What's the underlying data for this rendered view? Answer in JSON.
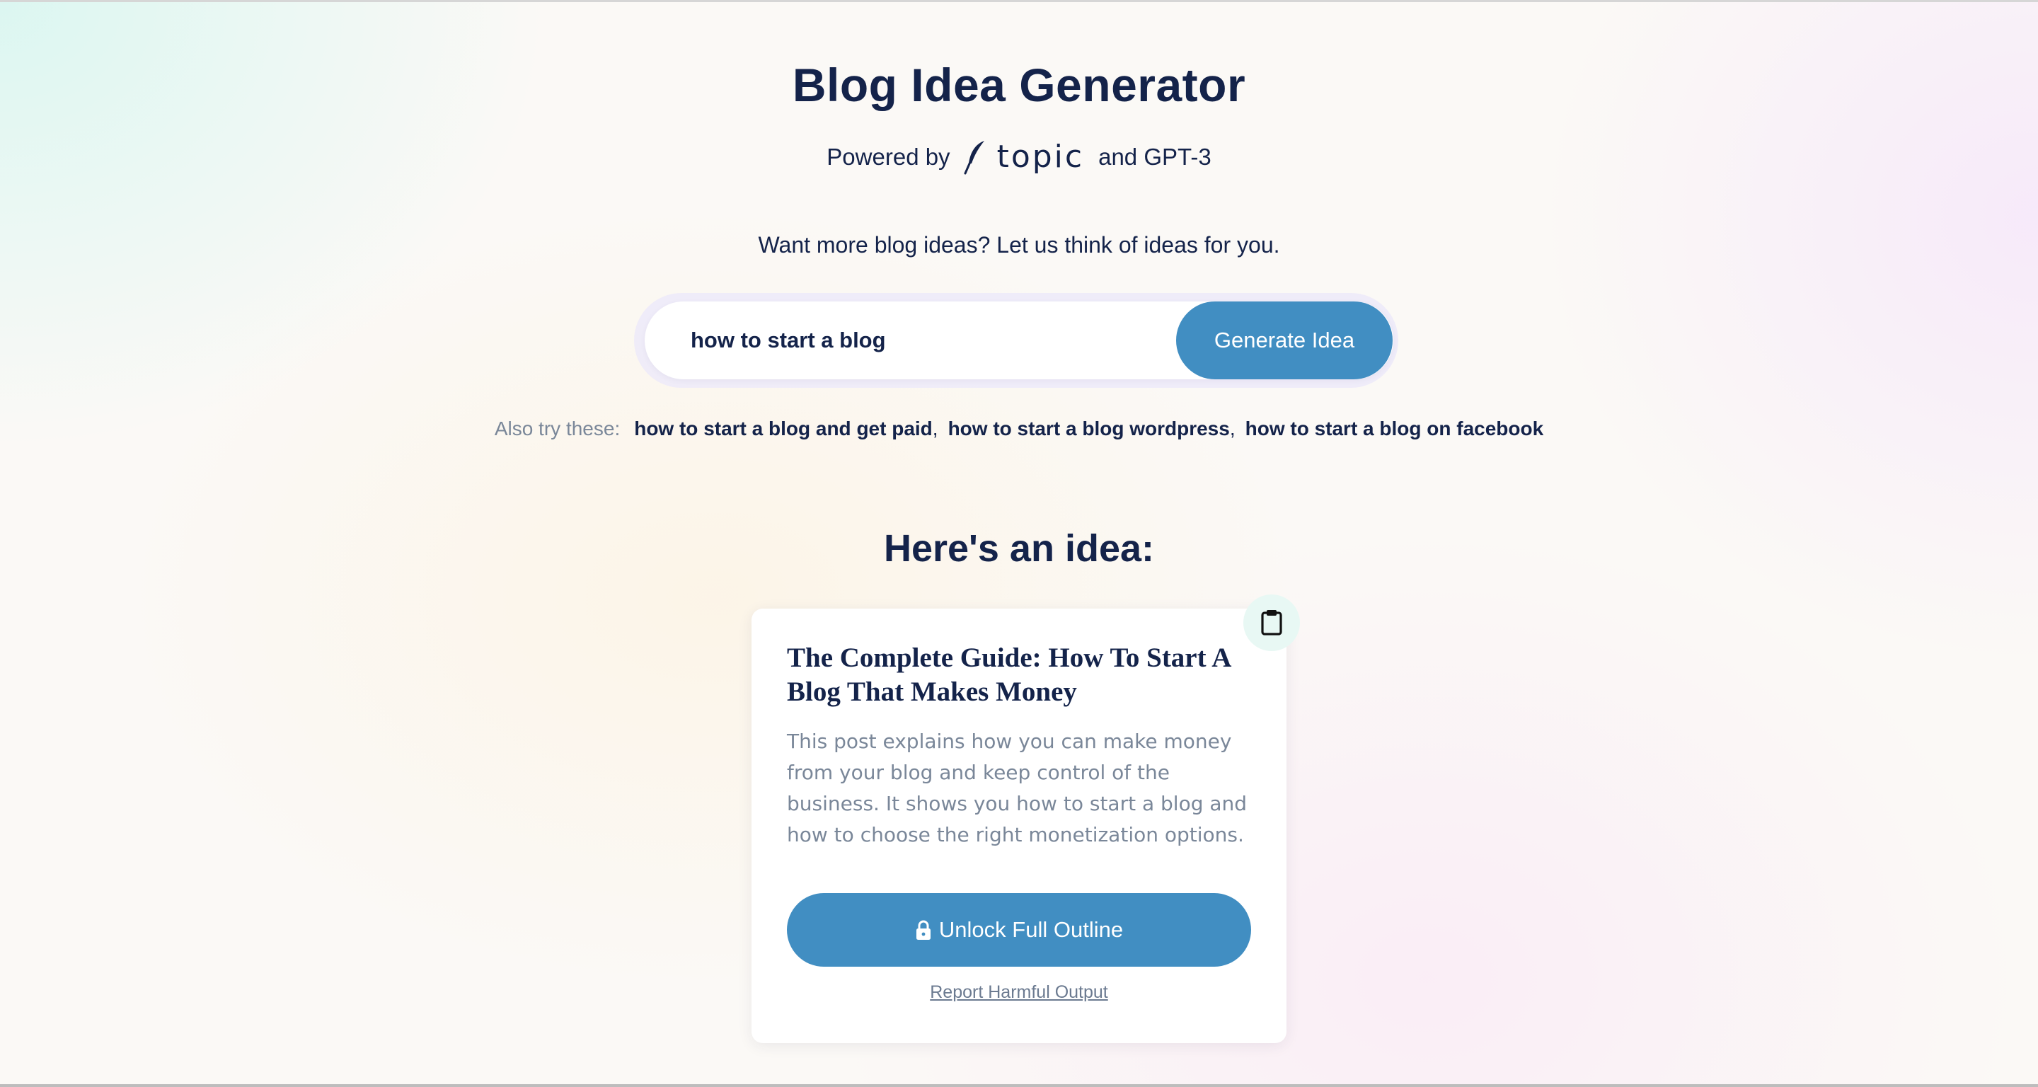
{
  "header": {
    "title": "Blog Idea Generator",
    "powered_prefix": "Powered by",
    "brand": "topic",
    "powered_suffix": "and GPT-3"
  },
  "tagline": "Want more blog ideas? Let us think of ideas for you.",
  "search": {
    "value": "how to start a blog",
    "button_label": "Generate Idea"
  },
  "suggestions": {
    "label": "Also try these:",
    "items": [
      "how to start a blog and get paid",
      "how to start a blog wordpress",
      "how to start a blog on facebook"
    ],
    "separator": ","
  },
  "idea": {
    "heading": "Here's an idea:",
    "title": "The Complete Guide: How To Start A Blog That Makes Money",
    "description": "This post explains how you can make money from your blog and keep control of the business. It shows you how to start a blog and how to choose the right monetization options.",
    "unlock_label": "Unlock Full Outline",
    "report_label": "Report Harmful Output"
  },
  "icons": {
    "brand_logo": "feather-icon",
    "copy": "clipboard-icon",
    "unlock": "lock-icon"
  },
  "colors": {
    "accent": "#418ec2",
    "text_dark": "#14234a",
    "text_muted": "#7a8799"
  }
}
